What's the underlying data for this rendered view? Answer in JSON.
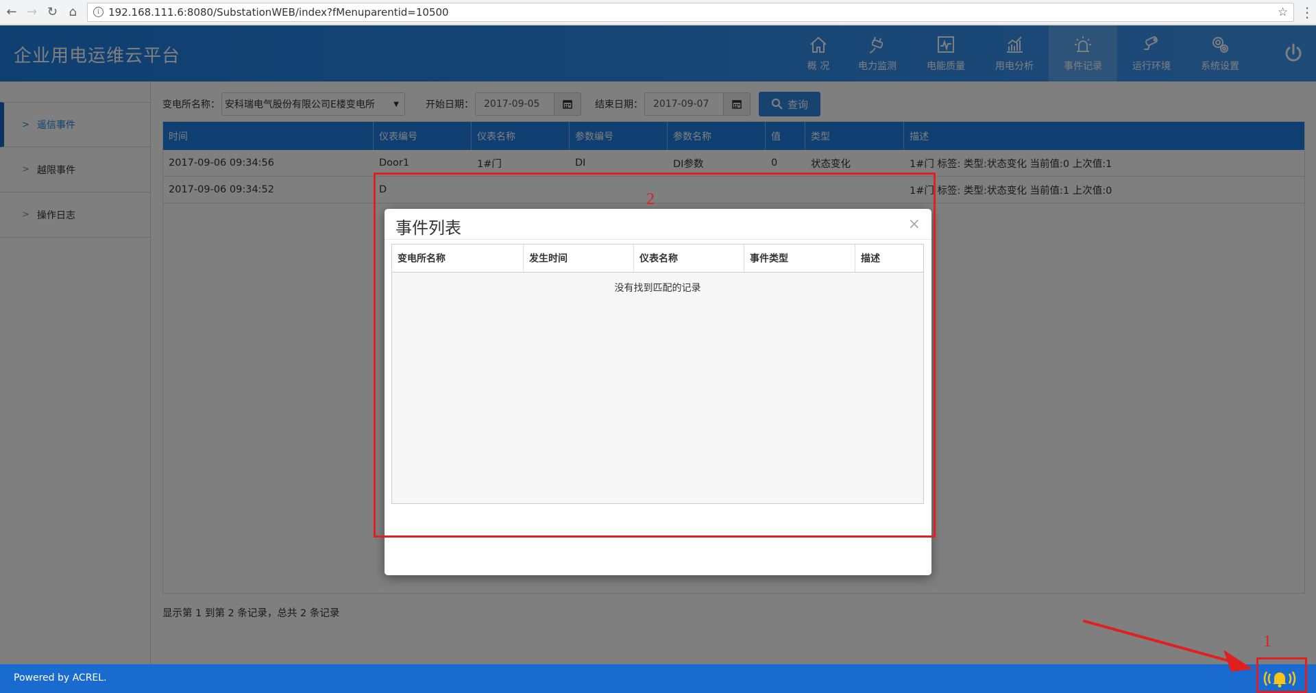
{
  "browser": {
    "url": "192.168.111.6:8080/SubstationWEB/index?fMenuparentid=10500"
  },
  "header": {
    "title": "企业用电运维云平台",
    "nav": [
      {
        "label": "概 况",
        "icon": "home-icon"
      },
      {
        "label": "电力监测",
        "icon": "plug-icon"
      },
      {
        "label": "电能质量",
        "icon": "waveform-chart-icon"
      },
      {
        "label": "用电分析",
        "icon": "bar-chart-icon"
      },
      {
        "label": "事件记录",
        "icon": "alarm-light-icon",
        "active": true
      },
      {
        "label": "运行环境",
        "icon": "camera-icon"
      },
      {
        "label": "系统设置",
        "icon": "gears-icon"
      }
    ]
  },
  "sidebar": {
    "items": [
      {
        "label": "遥信事件",
        "active": true
      },
      {
        "label": "越限事件"
      },
      {
        "label": "操作日志"
      }
    ]
  },
  "filters": {
    "substation_label": "变电所名称：",
    "substation_value": "安科瑞电气股份有限公司E楼变电所",
    "start_label": "开始日期：",
    "start_value": "2017-09-05",
    "end_label": "结束日期：",
    "end_value": "2017-09-07",
    "query_label": "查询"
  },
  "table": {
    "columns": [
      "时间",
      "仪表编号",
      "仪表名称",
      "参数编号",
      "参数名称",
      "值",
      "类型",
      "描述"
    ],
    "rows": [
      [
        "2017-09-06 09:34:56",
        "Door1",
        "1#门",
        "DI",
        "DI参数",
        "0",
        "状态变化",
        "1#门 标签: 类型:状态变化 当前值:0 上次值:1"
      ],
      [
        "2017-09-06 09:34:52",
        "D",
        "",
        "",
        "",
        "",
        "",
        "1#门 标签: 类型:状态变化 当前值:1 上次值:0"
      ]
    ]
  },
  "pager": {
    "text": "显示第 1 到第 2 条记录，总共 2 条记录"
  },
  "footer": {
    "text": "Powered by ACREL."
  },
  "modal": {
    "title": "事件列表",
    "close": "×",
    "columns": [
      "变电所名称",
      "发生时间",
      "仪表名称",
      "事件类型",
      "描述"
    ],
    "empty_text": "没有找到匹配的记录"
  },
  "annotations": {
    "label1": "1",
    "label2": "2",
    "color": "#e02020"
  },
  "colors": {
    "brand": "#1e7fe3",
    "footer": "#1a6bd0",
    "active_nav": "#5aa6f2"
  }
}
